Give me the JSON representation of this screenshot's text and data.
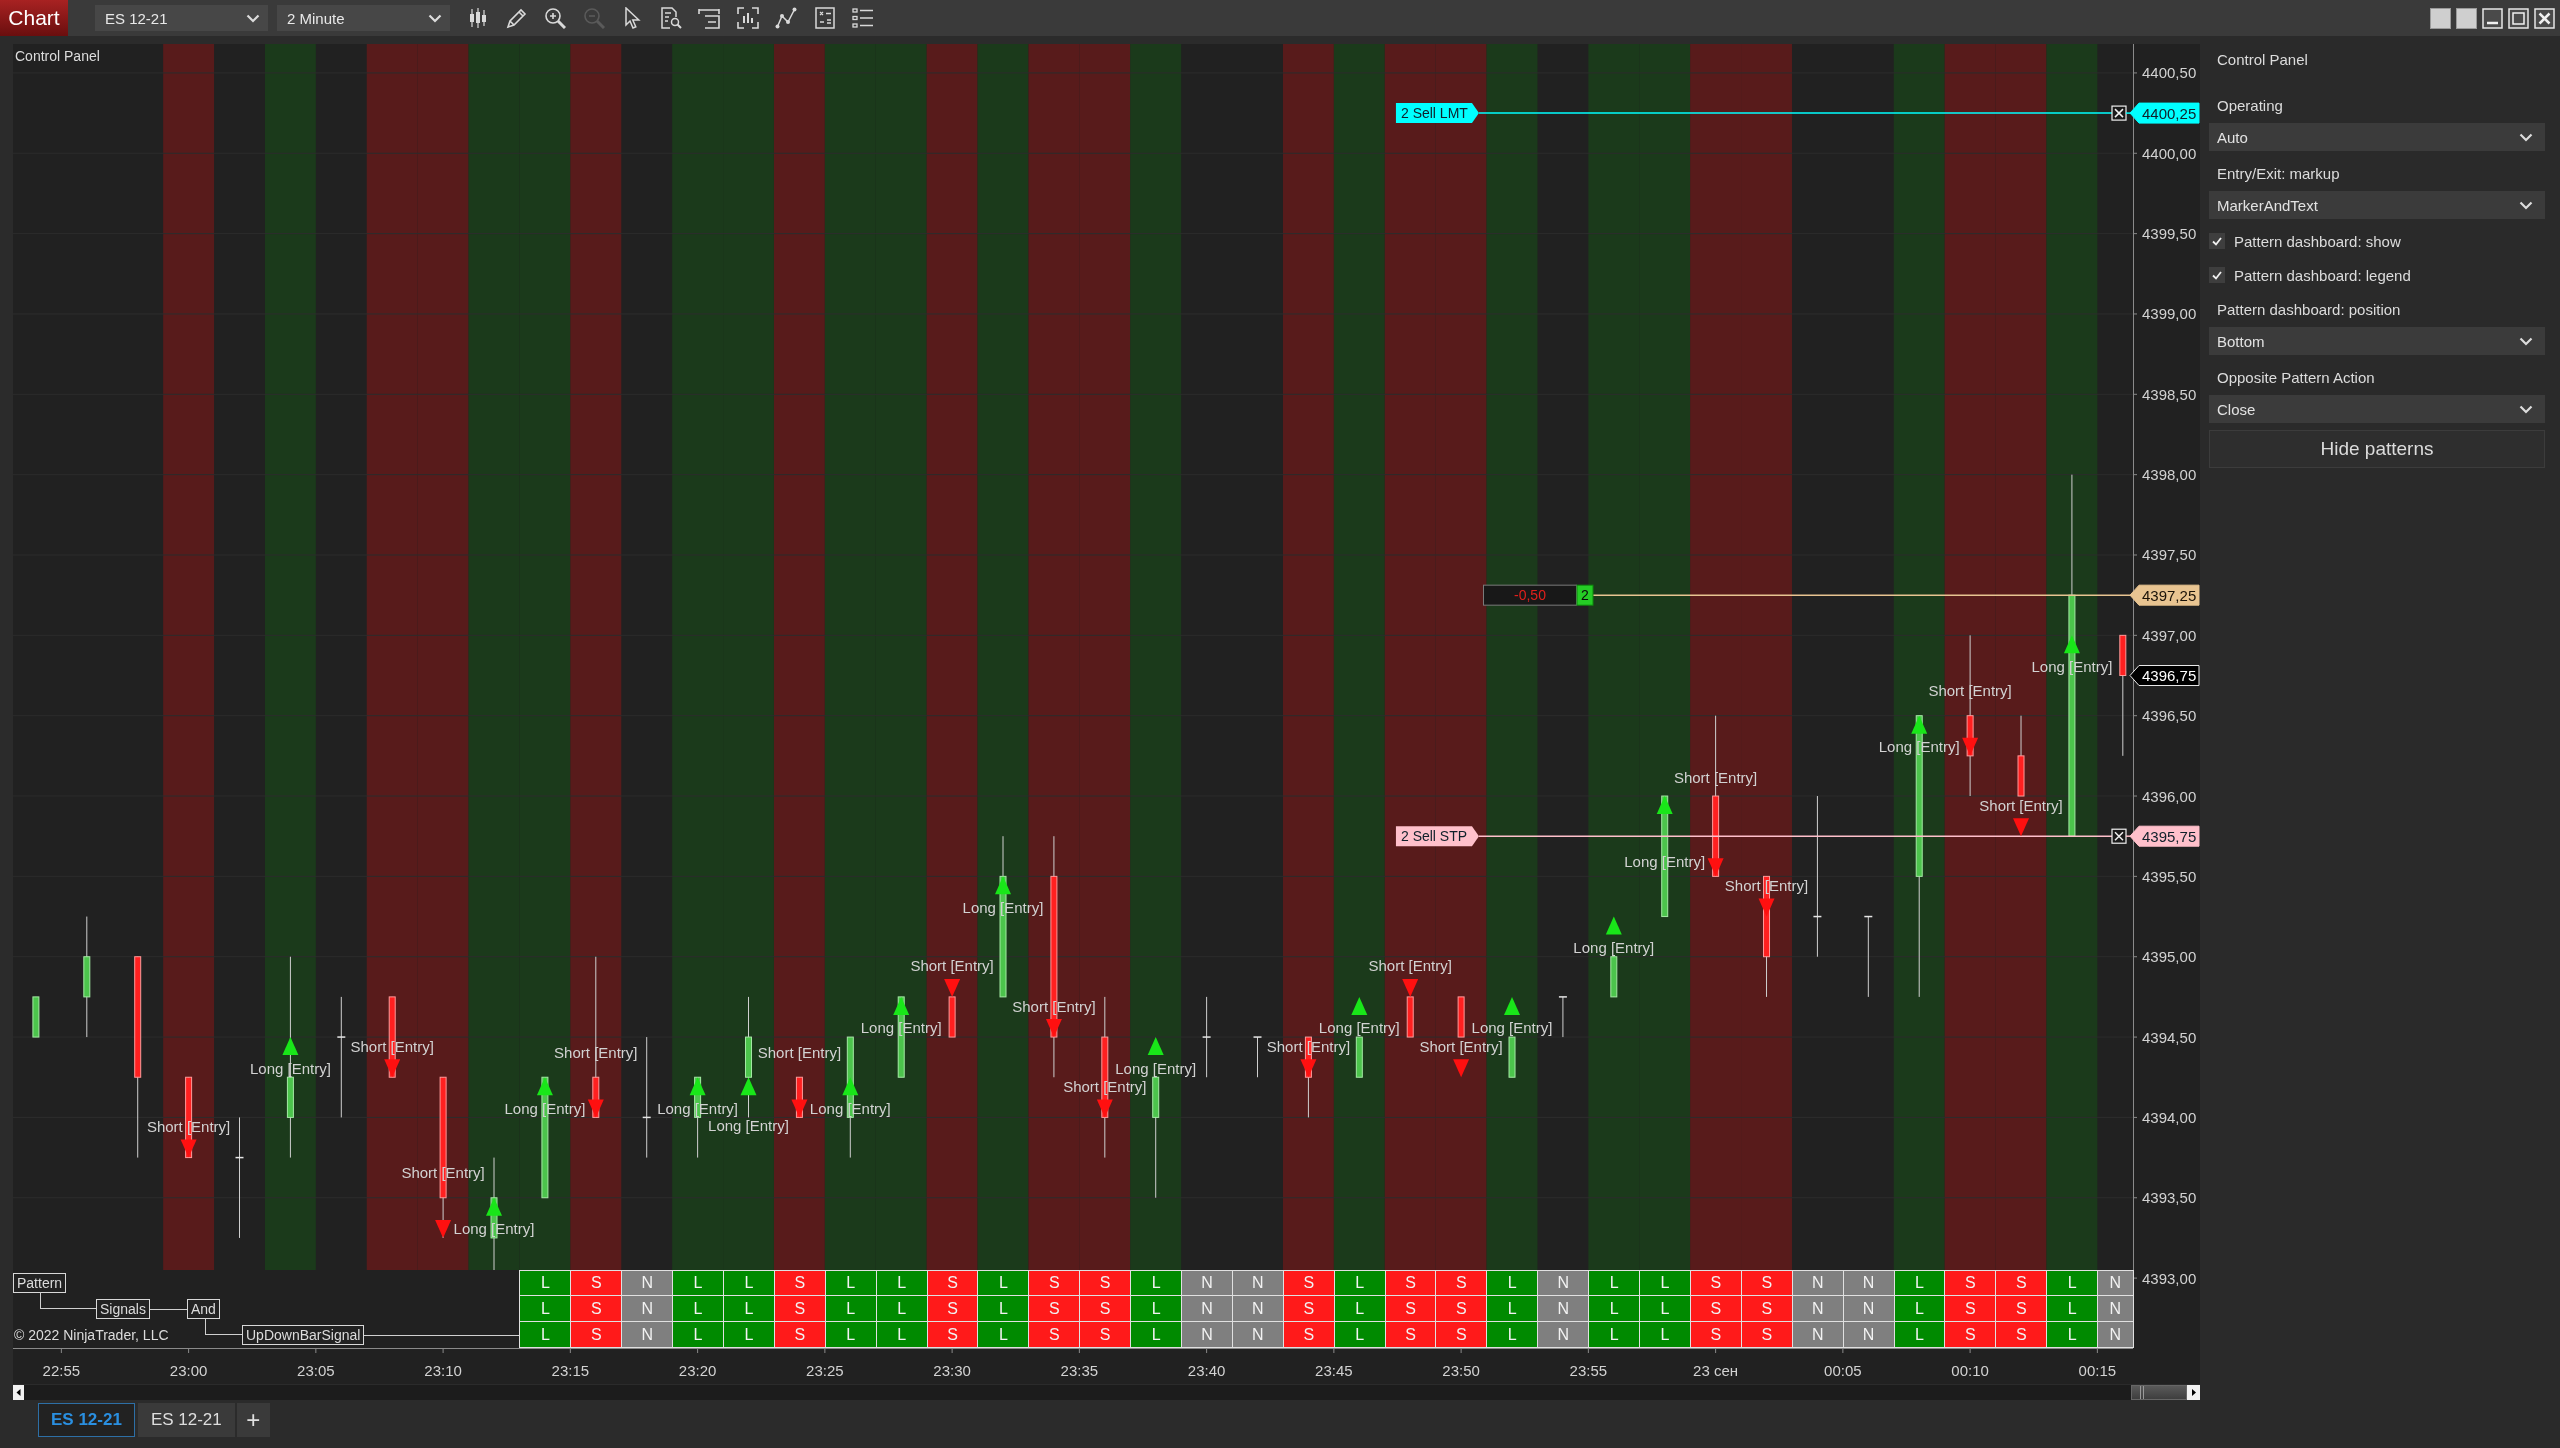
{
  "toolbar": {
    "app_label": "Chart",
    "instrument": "ES 12-21",
    "interval": "2 Minute",
    "tools": [
      {
        "kind": "bars",
        "disabled": false
      },
      {
        "kind": "pencil",
        "disabled": false
      },
      {
        "kind": "zoom_in",
        "disabled": false
      },
      {
        "kind": "zoom_out",
        "disabled": true
      },
      {
        "kind": "pointer",
        "disabled": false
      },
      {
        "kind": "document_search",
        "disabled": false
      },
      {
        "kind": "panel",
        "disabled": false
      },
      {
        "kind": "bar_frame",
        "disabled": false
      },
      {
        "kind": "line_nodes",
        "disabled": false
      },
      {
        "kind": "formula",
        "disabled": false
      },
      {
        "kind": "list",
        "disabled": false
      }
    ]
  },
  "chart": {
    "indicator_label": "Control Panel",
    "chart_data": {
      "type": "candlestick",
      "categories": [
        null,
        "22:55",
        null,
        "23:00",
        null,
        null,
        "23:05",
        null,
        "23:10",
        null,
        null,
        "23:15",
        null,
        "23:20",
        null,
        null,
        "23:25",
        null,
        "23:30",
        null,
        null,
        "23:35",
        null,
        "23:40",
        null,
        null,
        "23:45",
        null,
        "23:50",
        null,
        null,
        "23:55",
        null,
        "23 сен",
        null,
        null,
        "00:05",
        null,
        "00:10",
        null,
        null,
        "00:15"
      ],
      "grid": true,
      "ylim": [
        4392.565,
        4400.68
      ],
      "yticks": [
        {
          "value": 4400.5,
          "label": "4400,50"
        },
        {
          "value": 4400,
          "label": "4400,00"
        },
        {
          "value": 4399.5,
          "label": "4399,50"
        },
        {
          "value": 4399,
          "label": "4399,00"
        },
        {
          "value": 4398.5,
          "label": "4398,50"
        },
        {
          "value": 4398,
          "label": "4398,00"
        },
        {
          "value": 4397.5,
          "label": "4397,50"
        },
        {
          "value": 4397,
          "label": "4397,00"
        },
        {
          "value": 4396.5,
          "label": "4396,50"
        },
        {
          "value": 4396,
          "label": "4396,00"
        },
        {
          "value": 4395.5,
          "label": "4395,50"
        },
        {
          "value": 4395,
          "label": "4395,00"
        },
        {
          "value": 4394.5,
          "label": "4394,50"
        },
        {
          "value": 4394,
          "label": "4394,00"
        },
        {
          "value": 4393.5,
          "label": "4393,50"
        },
        {
          "value": 4393,
          "label": "4393,00"
        }
      ]
    },
    "bars": [
      {
        "kind": "none"
      },
      {
        "kind": "none"
      },
      {
        "kind": "none"
      },
      {
        "kind": "short",
        "entry": "Short [Entry]"
      },
      {
        "kind": "none"
      },
      {
        "kind": "long",
        "entry": "Long [Entry]"
      },
      {
        "kind": "none"
      },
      {
        "kind": "short",
        "entry": "Short [Entry]"
      },
      {
        "kind": "short",
        "entry": "Short [Entry]"
      },
      {
        "kind": "long",
        "entry": "Long [Entry]"
      },
      {
        "kind": "long",
        "entry": "Long [Entry]"
      },
      {
        "kind": "short",
        "entry": "Short [Entry]"
      },
      {
        "kind": "none"
      },
      {
        "kind": "long",
        "entry": "Long [Entry]"
      },
      {
        "kind": "long",
        "entry": "Long [Entry]"
      },
      {
        "kind": "short",
        "entry": "Short [Entry]"
      },
      {
        "kind": "long",
        "entry": "Long [Entry]"
      },
      {
        "kind": "long",
        "entry": "Long [Entry]"
      },
      {
        "kind": "short",
        "entry": "Short [Entry]"
      },
      {
        "kind": "long",
        "entry": "Long [Entry]"
      },
      {
        "kind": "short",
        "entry": "Short [Entry]"
      },
      {
        "kind": "short",
        "entry": "Short [Entry]"
      },
      {
        "kind": "long",
        "entry": "Long [Entry]"
      },
      {
        "kind": "none"
      },
      {
        "kind": "none"
      },
      {
        "kind": "short",
        "entry": "Short [Entry]"
      },
      {
        "kind": "long",
        "entry": "Long [Entry]"
      },
      {
        "kind": "short",
        "entry": "Short [Entry]"
      },
      {
        "kind": "short",
        "entry": "Short [Entry]"
      },
      {
        "kind": "long",
        "entry": "Long [Entry]"
      },
      {
        "kind": "none"
      },
      {
        "kind": "long",
        "entry": "Long [Entry]"
      },
      {
        "kind": "long",
        "entry": "Long [Entry]"
      },
      {
        "kind": "short",
        "entry": "Short [Entry]"
      },
      {
        "kind": "short",
        "entry": "Short [Entry]"
      },
      {
        "kind": "none"
      },
      {
        "kind": "none"
      },
      {
        "kind": "long",
        "entry": "Long [Entry]"
      },
      {
        "kind": "short",
        "entry": "Short [Entry]"
      },
      {
        "kind": "short",
        "entry": "Short [Entry]"
      },
      {
        "kind": "long",
        "entry": "Long [Entry]"
      },
      {
        "kind": "none"
      }
    ],
    "orders": [
      {
        "label": "2 Sell LMT",
        "price": "4400,25",
        "color": "#00ffff"
      },
      {
        "label": "2 Sell STP",
        "price": "4395,75",
        "color": "#ffc0cb"
      }
    ],
    "position": {
      "pnl": "-0,50",
      "quantity": "2",
      "price": "4397,25",
      "color": "#e8c491"
    },
    "last_price": "4396,75"
  },
  "dashboard": {
    "legend": {
      "label": "Pattern",
      "children": [
        {
          "label": "Signals",
          "children": [
            {
              "label": "And",
              "children": [
                {
                  "label": "UpDownBarSignal"
                }
              ]
            }
          ]
        }
      ]
    },
    "copyright": "© 2022 NinjaTrader, LLC",
    "rows": [
      {
        "cells": [
          {
            "text": "L",
            "kind": "long"
          },
          {
            "text": "S",
            "kind": "short"
          },
          {
            "text": "N",
            "kind": "none"
          },
          {
            "text": "L",
            "kind": "long"
          },
          {
            "text": "L",
            "kind": "long"
          },
          {
            "text": "S",
            "kind": "short"
          },
          {
            "text": "L",
            "kind": "long"
          },
          {
            "text": "L",
            "kind": "long"
          },
          {
            "text": "S",
            "kind": "short"
          },
          {
            "text": "L",
            "kind": "long"
          },
          {
            "text": "S",
            "kind": "short"
          },
          {
            "text": "S",
            "kind": "short"
          },
          {
            "text": "L",
            "kind": "long"
          },
          {
            "text": "N",
            "kind": "none"
          },
          {
            "text": "N",
            "kind": "none"
          },
          {
            "text": "S",
            "kind": "short"
          },
          {
            "text": "L",
            "kind": "long"
          },
          {
            "text": "S",
            "kind": "short"
          },
          {
            "text": "S",
            "kind": "short"
          },
          {
            "text": "L",
            "kind": "long"
          },
          {
            "text": "N",
            "kind": "none"
          },
          {
            "text": "L",
            "kind": "long"
          },
          {
            "text": "L",
            "kind": "long"
          },
          {
            "text": "S",
            "kind": "short"
          },
          {
            "text": "S",
            "kind": "short"
          },
          {
            "text": "N",
            "kind": "none"
          },
          {
            "text": "N",
            "kind": "none"
          },
          {
            "text": "L",
            "kind": "long"
          },
          {
            "text": "S",
            "kind": "short"
          },
          {
            "text": "S",
            "kind": "short"
          },
          {
            "text": "L",
            "kind": "long"
          },
          {
            "text": "N",
            "kind": "none"
          }
        ]
      },
      {
        "cells": [
          {
            "text": "L",
            "kind": "long"
          },
          {
            "text": "S",
            "kind": "short"
          },
          {
            "text": "N",
            "kind": "none"
          },
          {
            "text": "L",
            "kind": "long"
          },
          {
            "text": "L",
            "kind": "long"
          },
          {
            "text": "S",
            "kind": "short"
          },
          {
            "text": "L",
            "kind": "long"
          },
          {
            "text": "L",
            "kind": "long"
          },
          {
            "text": "S",
            "kind": "short"
          },
          {
            "text": "L",
            "kind": "long"
          },
          {
            "text": "S",
            "kind": "short"
          },
          {
            "text": "S",
            "kind": "short"
          },
          {
            "text": "L",
            "kind": "long"
          },
          {
            "text": "N",
            "kind": "none"
          },
          {
            "text": "N",
            "kind": "none"
          },
          {
            "text": "S",
            "kind": "short"
          },
          {
            "text": "L",
            "kind": "long"
          },
          {
            "text": "S",
            "kind": "short"
          },
          {
            "text": "S",
            "kind": "short"
          },
          {
            "text": "L",
            "kind": "long"
          },
          {
            "text": "N",
            "kind": "none"
          },
          {
            "text": "L",
            "kind": "long"
          },
          {
            "text": "L",
            "kind": "long"
          },
          {
            "text": "S",
            "kind": "short"
          },
          {
            "text": "S",
            "kind": "short"
          },
          {
            "text": "N",
            "kind": "none"
          },
          {
            "text": "N",
            "kind": "none"
          },
          {
            "text": "L",
            "kind": "long"
          },
          {
            "text": "S",
            "kind": "short"
          },
          {
            "text": "S",
            "kind": "short"
          },
          {
            "text": "L",
            "kind": "long"
          },
          {
            "text": "N",
            "kind": "none"
          }
        ]
      },
      {
        "cells": [
          {
            "text": "L",
            "kind": "long"
          },
          {
            "text": "S",
            "kind": "short"
          },
          {
            "text": "N",
            "kind": "none"
          },
          {
            "text": "L",
            "kind": "long"
          },
          {
            "text": "L",
            "kind": "long"
          },
          {
            "text": "S",
            "kind": "short"
          },
          {
            "text": "L",
            "kind": "long"
          },
          {
            "text": "L",
            "kind": "long"
          },
          {
            "text": "S",
            "kind": "short"
          },
          {
            "text": "L",
            "kind": "long"
          },
          {
            "text": "S",
            "kind": "short"
          },
          {
            "text": "S",
            "kind": "short"
          },
          {
            "text": "L",
            "kind": "long"
          },
          {
            "text": "N",
            "kind": "none"
          },
          {
            "text": "N",
            "kind": "none"
          },
          {
            "text": "S",
            "kind": "short"
          },
          {
            "text": "L",
            "kind": "long"
          },
          {
            "text": "S",
            "kind": "short"
          },
          {
            "text": "S",
            "kind": "short"
          },
          {
            "text": "L",
            "kind": "long"
          },
          {
            "text": "N",
            "kind": "none"
          },
          {
            "text": "L",
            "kind": "long"
          },
          {
            "text": "L",
            "kind": "long"
          },
          {
            "text": "S",
            "kind": "short"
          },
          {
            "text": "S",
            "kind": "short"
          },
          {
            "text": "N",
            "kind": "none"
          },
          {
            "text": "N",
            "kind": "none"
          },
          {
            "text": "L",
            "kind": "long"
          },
          {
            "text": "S",
            "kind": "short"
          },
          {
            "text": "S",
            "kind": "short"
          },
          {
            "text": "L",
            "kind": "long"
          },
          {
            "text": "N",
            "kind": "none"
          }
        ]
      }
    ]
  },
  "tabs": [
    {
      "label": "ES 12-21",
      "selected": true
    },
    {
      "label": "ES 12-21",
      "selected": false
    }
  ],
  "add_tab": "+",
  "control_panel": {
    "title": "Control Panel",
    "items": [
      {
        "kind": "select",
        "label": "Operating",
        "value": "Auto"
      },
      {
        "kind": "select",
        "label": "Entry/Exit: markup",
        "value": "MarkerAndText"
      },
      {
        "kind": "checkbox",
        "label": "Pattern dashboard: show",
        "checked": true
      },
      {
        "kind": "checkbox",
        "label": "Pattern dashboard: legend",
        "checked": true
      },
      {
        "kind": "select",
        "label": "Pattern dashboard: position",
        "value": "Bottom"
      },
      {
        "kind": "select",
        "label": "Opposite Pattern Action",
        "value": "Close"
      },
      {
        "kind": "button",
        "label": "Hide patterns"
      }
    ]
  }
}
